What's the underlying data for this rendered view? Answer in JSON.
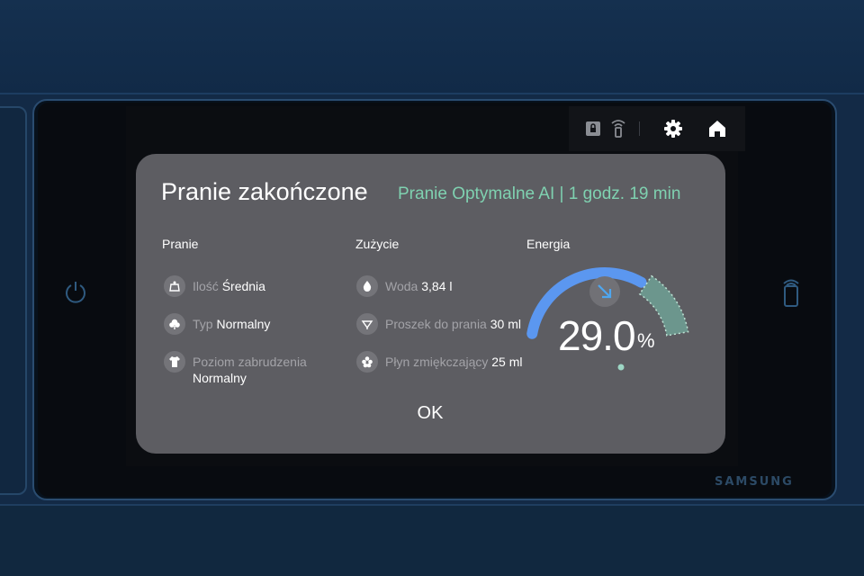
{
  "brand": "SAMSUNG",
  "status_icons": [
    "lock-icon",
    "remote-signal-icon",
    "gear-icon",
    "home-icon"
  ],
  "dialog": {
    "title": "Pranie zakończone",
    "subtitle": "Pranie Optymalne AI | 1 godz. 19 min",
    "ok_label": "OK"
  },
  "pranie": {
    "header": "Pranie",
    "items": [
      {
        "label": "Ilość",
        "value": "Średnia",
        "icon": "scale-icon"
      },
      {
        "label": "Typ",
        "value": "Normalny",
        "icon": "cloud-icon"
      },
      {
        "label": "Poziom zabrudzenia",
        "value": "Normalny",
        "icon": "shirt-icon"
      }
    ]
  },
  "zuzycie": {
    "header": "Zużycie",
    "items": [
      {
        "label": "Woda",
        "value": "3,84 l",
        "icon": "water-drop-icon"
      },
      {
        "label": "Proszek do prania",
        "value": "30 ml",
        "icon": "detergent-icon"
      },
      {
        "label": "Płyn zmiękczający",
        "value": "25 ml",
        "icon": "softener-icon"
      }
    ]
  },
  "energia": {
    "header": "Energia",
    "value": "29.0",
    "unit": "%",
    "saving_fraction": 0.29,
    "arc_color": "#5b97f0",
    "saved_color": "#6e9c92",
    "indicator_icon": "arrow-down-right-icon"
  }
}
